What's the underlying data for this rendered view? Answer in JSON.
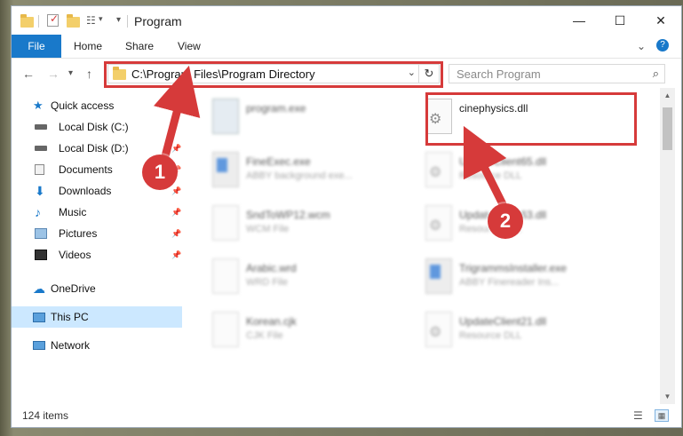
{
  "window": {
    "title": "Program",
    "minimize": "—",
    "maximize": "☐",
    "close": "✕"
  },
  "quick_access_toolbar": {
    "customize_arrow": "▾"
  },
  "ribbon": {
    "tabs": [
      "File",
      "Home",
      "Share",
      "View"
    ],
    "expand": "⌄",
    "help": "?"
  },
  "navigation": {
    "back": "←",
    "forward": "→",
    "recent": "▾",
    "up": "↑",
    "address": "C:\\Program Files\\Program Directory",
    "address_dropdown": "⌄",
    "refresh": "↻",
    "search_placeholder": "Search Program",
    "search_icon": "⌕"
  },
  "sidebar": {
    "items": [
      {
        "label": "Quick access",
        "icon": "star-icon",
        "pinned": false
      },
      {
        "label": "Local Disk (C:)",
        "icon": "drive-icon",
        "pinned": false
      },
      {
        "label": "Local Disk (D:)",
        "icon": "drive-icon",
        "pinned": true
      },
      {
        "label": "Documents",
        "icon": "documents-icon",
        "pinned": true
      },
      {
        "label": "Downloads",
        "icon": "download-icon",
        "pinned": true
      },
      {
        "label": "Music",
        "icon": "music-icon",
        "pinned": true
      },
      {
        "label": "Pictures",
        "icon": "pictures-icon",
        "pinned": true
      },
      {
        "label": "Videos",
        "icon": "videos-icon",
        "pinned": true
      },
      {
        "label": "OneDrive",
        "icon": "cloud-icon",
        "pinned": false
      },
      {
        "label": "This PC",
        "icon": "computer-icon",
        "pinned": false,
        "selected": true
      },
      {
        "label": "Network",
        "icon": "network-icon",
        "pinned": false
      }
    ],
    "pin_glyph": "📌"
  },
  "files": [
    {
      "name": "program.exe",
      "desc": "",
      "icon": "setup-icon"
    },
    {
      "name": "cinephysics.dll",
      "desc": "",
      "icon": "dll-gear-icon",
      "highlighted": true
    },
    {
      "name": "FineExec.exe",
      "desc": "ABBY background exe...",
      "icon": "app-icon"
    },
    {
      "name": "UpdateClient65.dll",
      "desc": "Resource DLL",
      "icon": "dll-gear-icon"
    },
    {
      "name": "SndToWP12.wcm",
      "desc": "WCM File",
      "icon": "document-icon"
    },
    {
      "name": "UpdateClient63.dll",
      "desc": "Resource DLL",
      "icon": "dll-gear-icon"
    },
    {
      "name": "Arabic.wrd",
      "desc": "WRD File",
      "icon": "document-icon"
    },
    {
      "name": "TrigrammsInstaller.exe",
      "desc": "ABBY Finereader Ins...",
      "icon": "app-icon"
    },
    {
      "name": "Korean.cjk",
      "desc": "CJK File",
      "icon": "document-icon"
    },
    {
      "name": "UpdateClient21.dll",
      "desc": "Resource DLL",
      "icon": "dll-gear-icon"
    }
  ],
  "status": {
    "item_count": "124 items"
  },
  "annotations": {
    "step1": "1",
    "step2": "2",
    "color": "#d63a3a"
  }
}
